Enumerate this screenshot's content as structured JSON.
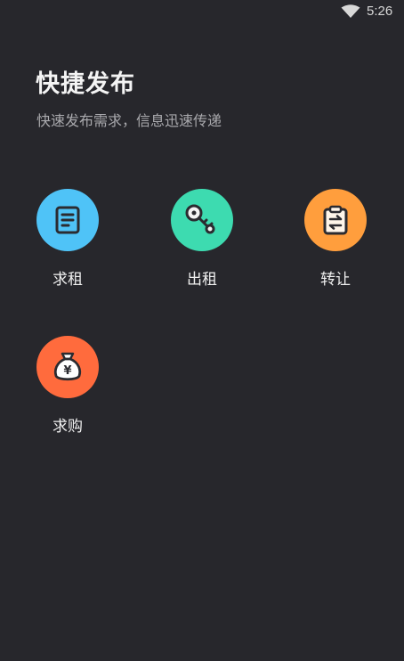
{
  "status_bar": {
    "time": "5:26",
    "icons": [
      "wifi-icon"
    ]
  },
  "header": {
    "title": "快捷发布",
    "subtitle": "快速发布需求，信息迅速传递"
  },
  "actions": [
    {
      "label": "求租",
      "icon": "document-icon",
      "color": "#4fc3f7"
    },
    {
      "label": "出租",
      "icon": "key-icon",
      "color": "#3ddbb0"
    },
    {
      "label": "转让",
      "icon": "clipboard-transfer-icon",
      "color": "#ff9e3d"
    },
    {
      "label": "求购",
      "icon": "money-bag-icon",
      "color": "#ff6b3d"
    }
  ],
  "colors": {
    "background": "#27272c",
    "title": "#f4f4f4",
    "subtitle": "#a9a9ad"
  }
}
